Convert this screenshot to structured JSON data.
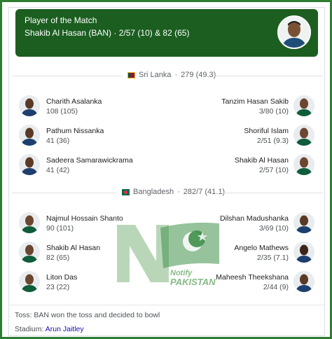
{
  "player_of_match": {
    "heading": "Player of the Match",
    "player": "Shakib Al Hasan (BAN)",
    "figures": " · 2/57 (10) & 82 (65)"
  },
  "innings": [
    {
      "team": "Sri Lanka",
      "score": "279 (49.3)",
      "batters": [
        {
          "name": "Charith Asalanka",
          "stat": "108 (105)"
        },
        {
          "name": "Pathum Nissanka",
          "stat": "41 (36)"
        },
        {
          "name": "Sadeera Samarawickrama",
          "stat": "41 (42)"
        }
      ],
      "bowlers": [
        {
          "name": "Tanzim Hasan Sakib",
          "stat": "3/80 (10)"
        },
        {
          "name": "Shoriful Islam",
          "stat": "2/51 (9.3)"
        },
        {
          "name": "Shakib Al Hasan",
          "stat": "2/57 (10)"
        }
      ]
    },
    {
      "team": "Bangladesh",
      "score": "282/7 (41.1)",
      "batters": [
        {
          "name": "Najmul Hossain Shanto",
          "stat": "90 (101)"
        },
        {
          "name": "Shakib Al Hasan",
          "stat": "82 (65)"
        },
        {
          "name": "Liton Das",
          "stat": "23 (22)"
        }
      ],
      "bowlers": [
        {
          "name": "Dilshan Madushanka",
          "stat": "3/69 (10)"
        },
        {
          "name": "Angelo Mathews",
          "stat": "2/35 (7.1)"
        },
        {
          "name": "Maheesh Theekshana",
          "stat": "2/44 (9)"
        }
      ]
    }
  ],
  "toss": "Toss: BAN won the toss and decided to bowl",
  "stadium_label": "Stadium: ",
  "stadium_name": "Arun Jaitley",
  "watermark": {
    "line1": "Notify",
    "line2": "PAKISTAN"
  },
  "colors": {
    "frame": "#2e7d32",
    "potm_bg": "#1b5e20",
    "link": "#1a0dab"
  }
}
